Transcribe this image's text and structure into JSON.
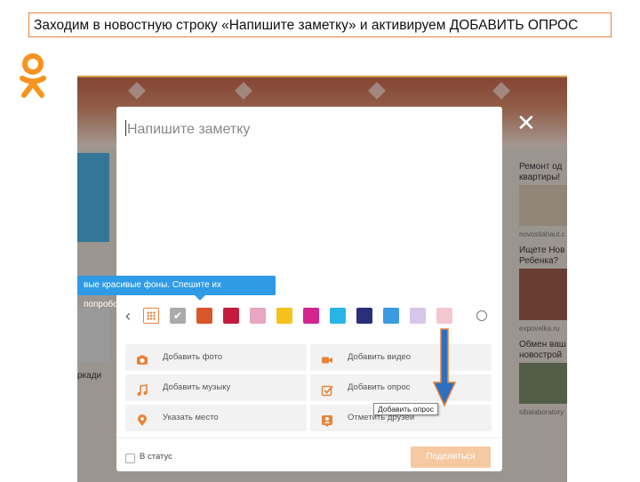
{
  "instruction": "Заходим в новостную строку «Напишите заметку» и активируем ДОБАВИТЬ ОПРОС",
  "modal": {
    "note_placeholder": "Напишите заметку",
    "close_glyph": "✕",
    "backgrounds_promo": "вые красивые фоны. Спешите их попробовать!",
    "backgrounds": [
      {
        "name": "grid",
        "color": "#ffffff"
      },
      {
        "name": "check",
        "color": "#aaaaaa"
      },
      {
        "name": "orange-pattern",
        "color": "#d8572a"
      },
      {
        "name": "red",
        "color": "#c41a3c"
      },
      {
        "name": "pink-flowers",
        "color": "#e7a6c1"
      },
      {
        "name": "yellow-star",
        "color": "#f4c21b"
      },
      {
        "name": "magenta-dots",
        "color": "#d6248e"
      },
      {
        "name": "cyan",
        "color": "#28b6e6"
      },
      {
        "name": "navy-stars",
        "color": "#2b2f7a"
      },
      {
        "name": "blue-cloud",
        "color": "#3a9be3"
      },
      {
        "name": "lavender",
        "color": "#d6c6ea"
      },
      {
        "name": "light-pink",
        "color": "#f3c7cf"
      }
    ],
    "actions": [
      {
        "label": "Добавить фото",
        "icon": "camera-icon"
      },
      {
        "label": "Добавить видео",
        "icon": "video-camera-icon"
      },
      {
        "label": "Добавить музыку",
        "icon": "music-note-icon"
      },
      {
        "label": "Добавить опрос",
        "icon": "poll-check-icon"
      },
      {
        "label": "Указать место",
        "icon": "location-pin-icon"
      },
      {
        "label": "Отметить друзей",
        "icon": "person-tag-icon"
      }
    ],
    "tooltip_hint": "Добавить опрос",
    "status_label": "В статус",
    "share_label": "Поделиться"
  },
  "right_sidebar": {
    "items": [
      {
        "title": "Ремонт од квартиры!",
        "source": "novostiahaut.c"
      },
      {
        "title": "Ищете Нов Ребенка?",
        "source": "expovelka.ru"
      },
      {
        "title": "Обмен ваш новострой",
        "source": "sibalaboratory"
      }
    ]
  },
  "left_partial_text": "ркади",
  "colors": {
    "accent": "#e8833a",
    "ok_orange": "#f7931e",
    "tooltip_blue": "#2f9be7",
    "arrow_fill": "#2f6fc0",
    "arrow_stroke": "#e8833a"
  }
}
